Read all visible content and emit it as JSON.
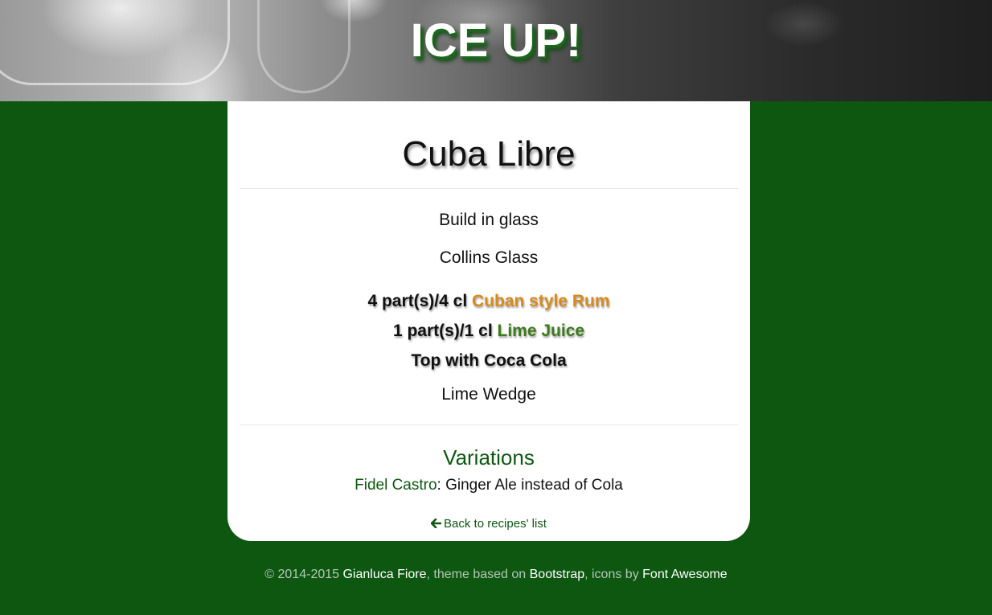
{
  "header": {
    "title": "ICE UP!"
  },
  "recipe": {
    "title": "Cuba Libre",
    "method": "Build in glass",
    "glass": "Collins Glass",
    "ingredients": [
      {
        "amount": "4 part(s)/4 cl",
        "name": "Cuban style Rum",
        "color": "#d88a1a"
      },
      {
        "amount": "1 part(s)/1 cl",
        "name": "Lime Juice",
        "color": "#3e7a1d"
      },
      {
        "amount": "Top with Coca Cola",
        "name": "",
        "color": ""
      }
    ],
    "garnish": "Lime Wedge"
  },
  "variations": {
    "title": "Variations",
    "items": [
      {
        "name": "Fidel Castro",
        "separator": ":",
        "description": "Ginger Ale instead of Cola"
      }
    ]
  },
  "back_link": {
    "icon": "arrow-left-icon",
    "label": "Back to recipes' list"
  },
  "footer": {
    "copyright": "© 2014-2015",
    "author": "Gianluca Fiore",
    "theme_text": ", theme based on",
    "theme_link": "Bootstrap",
    "icons_text": ", icons by",
    "icons_link": "Font Awesome"
  },
  "colors": {
    "page_background": "#0d5711",
    "accent_green": "#0d5711",
    "rum_orange": "#d88a1a",
    "lime_green": "#3e7a1d"
  }
}
